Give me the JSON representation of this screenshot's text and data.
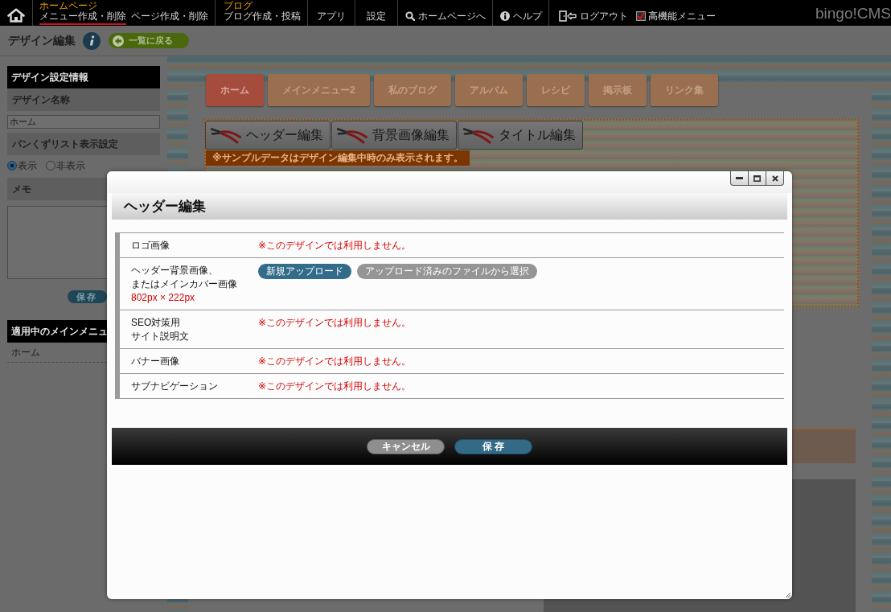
{
  "top_nav": {
    "groups": [
      {
        "items": [
          {
            "kind": "home",
            "selected": false
          }
        ]
      },
      {
        "items": [
          {
            "kind": "link",
            "caption": "ホームページ",
            "label": "メニュー作成・削除",
            "selected": true
          },
          {
            "kind": "link",
            "label": "ページ作成・削除",
            "selected": false
          }
        ]
      },
      {
        "items": [
          {
            "kind": "link",
            "caption": "ブログ",
            "label": "ブログ作成・投稿",
            "selected": false
          }
        ]
      },
      {
        "items": [
          {
            "kind": "link",
            "label": "アプリ",
            "selected": false
          }
        ]
      },
      {
        "items": [
          {
            "kind": "link",
            "label": "設定",
            "selected": false
          }
        ]
      },
      {
        "items": [
          {
            "kind": "search",
            "label": "ホームページへ",
            "selected": false
          }
        ]
      },
      {
        "items": [
          {
            "kind": "help",
            "label": "ヘルプ",
            "selected": false
          }
        ]
      },
      {
        "items": [
          {
            "kind": "logout",
            "label": "ログアウト",
            "selected": false
          },
          {
            "kind": "checkbox",
            "label": "高機能メニュー",
            "checked": true
          }
        ]
      }
    ],
    "logo": "bingo!CMS"
  },
  "page_header": {
    "title": "デザイン編集",
    "back_button": "一覧に戻る"
  },
  "sidebar": {
    "blocks": [
      {
        "kind": "title",
        "text": "デザイン設定情報"
      },
      {
        "kind": "label",
        "text": "デザイン名称"
      },
      {
        "kind": "input",
        "value": "ホーム"
      },
      {
        "kind": "label",
        "text": "パンくずリスト表示設定"
      },
      {
        "kind": "radios",
        "options": [
          {
            "label": "表示",
            "selected": true
          },
          {
            "label": "非表示",
            "selected": false
          }
        ]
      },
      {
        "kind": "label",
        "text": "メモ"
      },
      {
        "kind": "textarea"
      },
      {
        "kind": "button",
        "text": "保存"
      },
      {
        "kind": "title",
        "text": "適用中のメインメニュ"
      },
      {
        "kind": "item",
        "text": "ホーム"
      }
    ]
  },
  "preview": {
    "menu_tabs": [
      {
        "label": "ホーム",
        "selected": true
      },
      {
        "label": "メインメニュー2",
        "selected": false
      },
      {
        "label": "私のブログ",
        "selected": false
      },
      {
        "label": "アルバム",
        "selected": false
      },
      {
        "label": "レシピ",
        "selected": false
      },
      {
        "label": "掲示板",
        "selected": false
      },
      {
        "label": "リンク集",
        "selected": false
      }
    ],
    "edit_buttons": [
      "ヘッダー編集",
      "背景画像編集",
      "タイトル編集"
    ],
    "notice": "※サンプルデータはデザイン編集中時のみ表示されます。"
  },
  "dialog": {
    "title": "ヘッダー編集",
    "rows": [
      {
        "label_lines": [
          "ロゴ画像"
        ],
        "kind": "unavailable",
        "message": "※このデザインでは利用しません。"
      },
      {
        "label_lines": [
          "ヘッダー背景画像、",
          "またはメインカバー画像"
        ],
        "note": "802px × 222px",
        "kind": "upload",
        "buttons": [
          {
            "label": "新規アップロード",
            "kind": "primary"
          },
          {
            "label": "アップロード済みのファイルから選択",
            "kind": "secondary"
          }
        ]
      },
      {
        "label_lines": [
          "SEO対策用",
          "サイト説明文"
        ],
        "kind": "unavailable",
        "message": "※このデザインでは利用しません。"
      },
      {
        "label_lines": [
          "バナー画像"
        ],
        "kind": "unavailable",
        "message": "※このデザインでは利用しません。"
      },
      {
        "label_lines": [
          "サブナビゲーション"
        ],
        "kind": "unavailable",
        "message": "※このデザインでは利用しません。"
      }
    ],
    "buttons": [
      {
        "label": "キャンセル",
        "kind": "cancel"
      },
      {
        "label": "保 存",
        "kind": "save"
      }
    ]
  }
}
